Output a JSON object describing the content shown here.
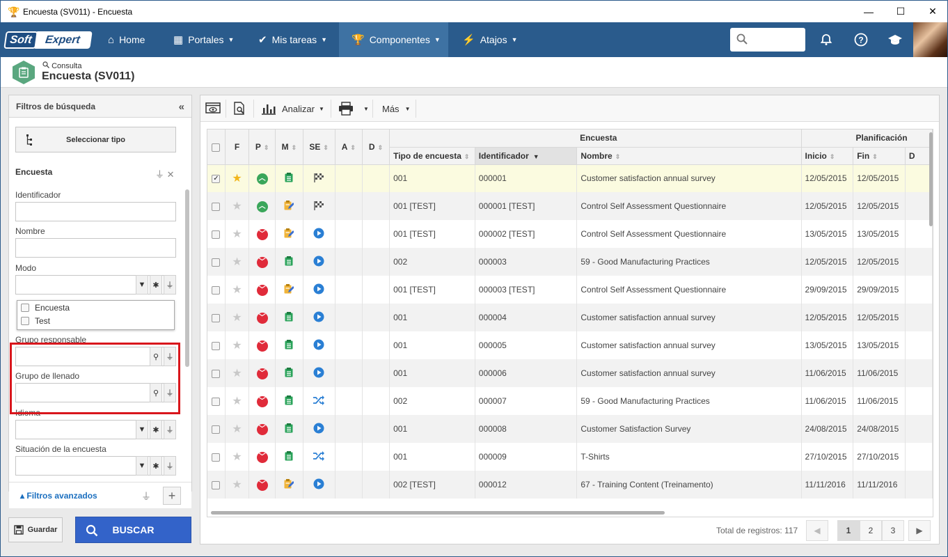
{
  "window": {
    "title": "Encuesta (SV011) - Encuesta",
    "minimize": "—",
    "maximize": "☐",
    "close": "✕"
  },
  "nav": {
    "logo_left": "Soft",
    "logo_right": "Expert",
    "items": [
      {
        "label": "Home",
        "icon": "home-icon"
      },
      {
        "label": "Portales",
        "icon": "grid-icon"
      },
      {
        "label": "Mis tareas",
        "icon": "check-icon"
      },
      {
        "label": "Componentes",
        "icon": "trophy-icon"
      },
      {
        "label": "Atajos",
        "icon": "bolt-icon"
      }
    ],
    "active_color": "#3e72a3",
    "bar_color": "#2a5b8c"
  },
  "header": {
    "breadcrumb": "Consulta",
    "title": "Encuesta (SV011)"
  },
  "filters": {
    "title": "Filtros de búsqueda",
    "select_type": "Seleccionar tipo",
    "section": "Encuesta",
    "fields": {
      "identificador": "Identificador",
      "nombre": "Nombre",
      "modo": "Modo",
      "grupo_responsable": "Grupo responsable",
      "grupo_llenado": "Grupo de llenado",
      "idioma": "Idioma",
      "situacion": "Situación de la encuesta"
    },
    "modo_options": [
      "Encuesta",
      "Test"
    ],
    "advanced": "Filtros avanzados",
    "save": "Guardar",
    "search": "BUSCAR"
  },
  "toolbar": {
    "analizar": "Analizar",
    "mas": "Más"
  },
  "grid": {
    "group_encuesta": "Encuesta",
    "group_plan": "Planificación",
    "headers": {
      "f": "F",
      "p": "P",
      "m": "M",
      "se": "SE",
      "a": "A",
      "d": "D",
      "tipo": "Tipo de encuesta",
      "ident": "Identificador",
      "nombre": "Nombre",
      "inicio": "Inicio",
      "fin": "Fin",
      "extra": "D"
    },
    "rows": [
      {
        "tipo": "001",
        "ident": "000001",
        "nombre": "Customer satisfaction annual survey",
        "inicio": "12/05/2015",
        "fin": "12/05/2015",
        "checked": true,
        "star": true,
        "p": "green",
        "m": "clipboard",
        "se": "flag"
      },
      {
        "tipo": "001 [TEST]",
        "ident": "000001 [TEST]",
        "nombre": "Control Self Assessment Questionnaire",
        "inicio": "12/05/2015",
        "fin": "12/05/2015",
        "checked": false,
        "star": false,
        "p": "green",
        "m": "edit",
        "se": "flag"
      },
      {
        "tipo": "001 [TEST]",
        "ident": "000002 [TEST]",
        "nombre": "Control Self Assessment Questionnaire",
        "inicio": "13/05/2015",
        "fin": "13/05/2015",
        "checked": false,
        "star": false,
        "p": "red",
        "m": "edit",
        "se": "play"
      },
      {
        "tipo": "002",
        "ident": "000003",
        "nombre": "59 - Good Manufacturing Practices",
        "inicio": "12/05/2015",
        "fin": "12/05/2015",
        "checked": false,
        "star": false,
        "p": "red",
        "m": "clipboard",
        "se": "play"
      },
      {
        "tipo": "001 [TEST]",
        "ident": "000003 [TEST]",
        "nombre": "Control Self Assessment Questionnaire",
        "inicio": "29/09/2015",
        "fin": "29/09/2015",
        "checked": false,
        "star": false,
        "p": "red",
        "m": "edit",
        "se": "play"
      },
      {
        "tipo": "001",
        "ident": "000004",
        "nombre": "Customer satisfaction annual survey",
        "inicio": "12/05/2015",
        "fin": "12/05/2015",
        "checked": false,
        "star": false,
        "p": "red",
        "m": "clipboard",
        "se": "play"
      },
      {
        "tipo": "001",
        "ident": "000005",
        "nombre": "Customer satisfaction annual survey",
        "inicio": "13/05/2015",
        "fin": "13/05/2015",
        "checked": false,
        "star": false,
        "p": "red",
        "m": "clipboard",
        "se": "play"
      },
      {
        "tipo": "001",
        "ident": "000006",
        "nombre": "Customer satisfaction annual survey",
        "inicio": "11/06/2015",
        "fin": "11/06/2015",
        "checked": false,
        "star": false,
        "p": "red",
        "m": "clipboard",
        "se": "play"
      },
      {
        "tipo": "002",
        "ident": "000007",
        "nombre": "59 - Good Manufacturing Practices",
        "inicio": "11/06/2015",
        "fin": "11/06/2015",
        "checked": false,
        "star": false,
        "p": "red",
        "m": "clipboard",
        "se": "shuffle"
      },
      {
        "tipo": "001",
        "ident": "000008",
        "nombre": "Customer Satisfaction Survey",
        "inicio": "24/08/2015",
        "fin": "24/08/2015",
        "checked": false,
        "star": false,
        "p": "red",
        "m": "clipboard",
        "se": "play"
      },
      {
        "tipo": "001",
        "ident": "000009",
        "nombre": "T-Shirts",
        "inicio": "27/10/2015",
        "fin": "27/10/2015",
        "checked": false,
        "star": false,
        "p": "red",
        "m": "clipboard",
        "se": "shuffle"
      },
      {
        "tipo": "002 [TEST]",
        "ident": "000012",
        "nombre": "67 - Training Content (Treinamento)",
        "inicio": "11/11/2016",
        "fin": "11/11/2016",
        "checked": false,
        "star": false,
        "p": "red",
        "m": "edit",
        "se": "play"
      }
    ]
  },
  "pager": {
    "total": "Total de registros: 117",
    "pages": [
      "1",
      "2",
      "3"
    ],
    "prev": "◀",
    "next": "▶"
  },
  "colors": {
    "buscar": "#3363c9",
    "highlight": "#d9161c",
    "selected_row": "#fbfbe0"
  }
}
